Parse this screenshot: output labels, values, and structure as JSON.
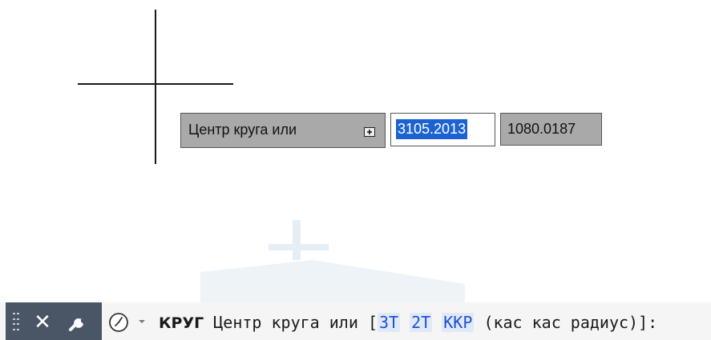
{
  "dynamic_input": {
    "prompt": "Центр круга или",
    "x_value": "3105.2013",
    "y_value": "1080.0187"
  },
  "command_line": {
    "command_name": "КРУГ",
    "prompt": "Центр круга или",
    "open_bracket": "[",
    "options": [
      "3T",
      "2T",
      "ККР"
    ],
    "options_note": "(кас кас радиус)",
    "close_bracket": "]:",
    "icons": {
      "close": "close-icon",
      "customize": "wrench-icon",
      "recent": "clock-icon",
      "dropdown": "chevron-down-icon"
    }
  },
  "colors": {
    "command_bar_left": "#4a5566",
    "tooltip_gray": "#a9a9a9",
    "selection_blue": "#1c63d1",
    "option_blue": "#1f4fd8"
  }
}
